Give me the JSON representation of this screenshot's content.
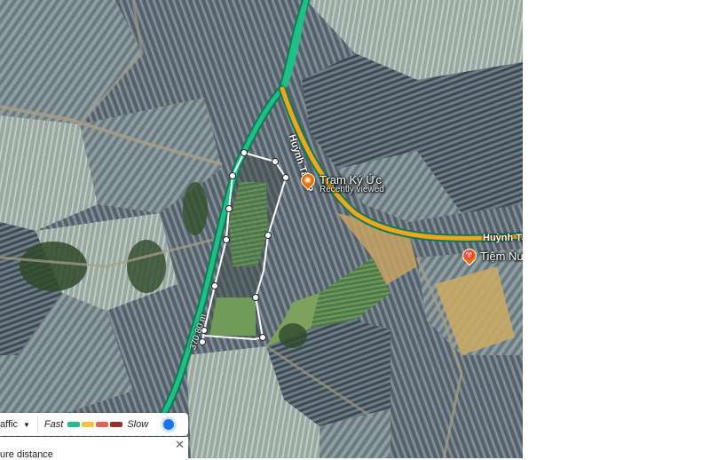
{
  "map": {
    "places": [
      {
        "name": "Trạm Ký Ức",
        "subtitle": "Recently viewed",
        "icon": "camera-icon"
      },
      {
        "name": "Tiệm Nướ",
        "icon": "restaurant-icon"
      }
    ],
    "roads": {
      "vertical": "Huỳnh Tấn P",
      "horizontal": "Huỳnh Tấ"
    },
    "measure_distance_label": "370.80 m"
  },
  "traffic_bar": {
    "label": "affic",
    "fast_label": "Fast",
    "slow_label": "Slow",
    "legend_colors": [
      "#1fbf86",
      "#f2c33b",
      "#e66150",
      "#a52a2a"
    ],
    "toggle_on": true
  },
  "measure_bar": {
    "text": "ure distance",
    "close_symbol": "✕"
  },
  "colors": {
    "route_green": "#1fbf86",
    "route_orange": "#f0a51c",
    "measure_line": "#ffffff"
  }
}
